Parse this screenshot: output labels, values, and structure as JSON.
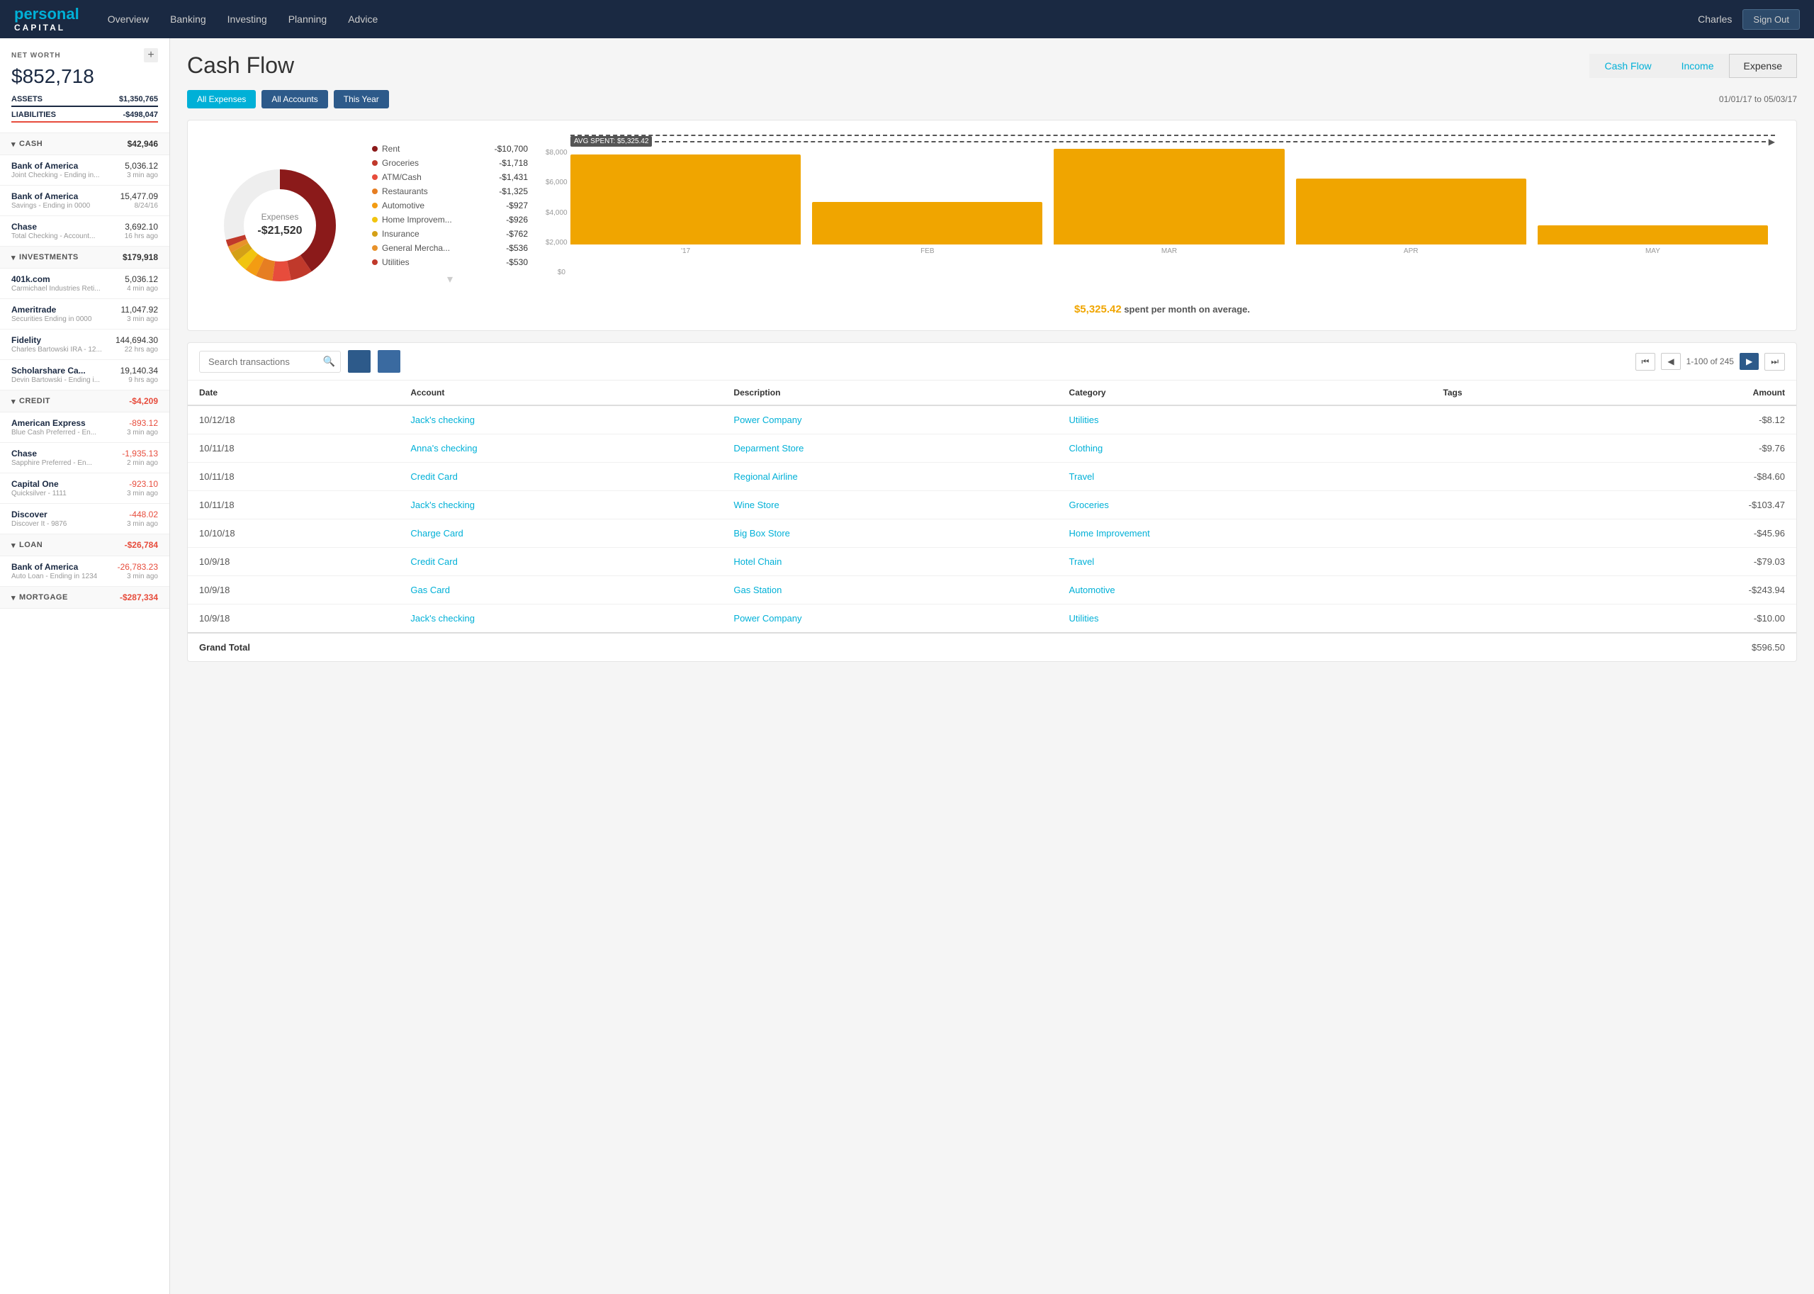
{
  "header": {
    "logo_line1": "personal",
    "logo_line2": "CAPITAL",
    "nav": [
      "Overview",
      "Banking",
      "Investing",
      "Planning",
      "Advice"
    ],
    "user": "Charles",
    "signout": "Sign Out"
  },
  "sidebar": {
    "add_btn": "+",
    "net_worth_label": "NET WORTH",
    "net_worth_value": "$852,718",
    "assets_label": "ASSETS",
    "assets_value": "$1,350,765",
    "liabilities_label": "LIABILITIES",
    "liabilities_value": "-$498,047",
    "sections": [
      {
        "label": "CASH",
        "value": "$42,946",
        "negative": false,
        "accounts": [
          {
            "name": "Bank of America",
            "sub": "Joint Checking - Ending in...",
            "amount": "5,036.12",
            "time": "3 min ago",
            "negative": false
          },
          {
            "name": "Bank of America",
            "sub": "Savings - Ending in 0000",
            "amount": "15,477.09",
            "time": "8/24/16",
            "negative": false
          },
          {
            "name": "Chase",
            "sub": "Total Checking - Account...",
            "amount": "3,692.10",
            "time": "16 hrs ago",
            "negative": false
          }
        ]
      },
      {
        "label": "INVESTMENTS",
        "value": "$179,918",
        "negative": false,
        "accounts": [
          {
            "name": "401k.com",
            "sub": "Carmichael Industries Reti...",
            "amount": "5,036.12",
            "time": "4 min ago",
            "negative": false
          },
          {
            "name": "Ameritrade",
            "sub": "Securities Ending in 0000",
            "amount": "11,047.92",
            "time": "3 min ago",
            "negative": false
          },
          {
            "name": "Fidelity",
            "sub": "Charles Bartowski IRA - 12...",
            "amount": "144,694.30",
            "time": "22 hrs ago",
            "negative": false
          },
          {
            "name": "Scholarshare Ca...",
            "sub": "Devin Bartowski - Ending i...",
            "amount": "19,140.34",
            "time": "9 hrs ago",
            "negative": false
          }
        ]
      },
      {
        "label": "CREDIT",
        "value": "-$4,209",
        "negative": true,
        "accounts": [
          {
            "name": "American Express",
            "sub": "Blue Cash Preferred - En...",
            "amount": "-893.12",
            "time": "3 min ago",
            "negative": true
          },
          {
            "name": "Chase",
            "sub": "Sapphire Preferred - En...",
            "amount": "-1,935.13",
            "time": "2 min ago",
            "negative": true
          },
          {
            "name": "Capital One",
            "sub": "Quicksilver - 1111",
            "amount": "-923.10",
            "time": "3 min ago",
            "negative": true
          },
          {
            "name": "Discover",
            "sub": "Discover It - 9876",
            "amount": "-448.02",
            "time": "3 min ago",
            "negative": true
          }
        ]
      },
      {
        "label": "LOAN",
        "value": "-$26,784",
        "negative": true,
        "accounts": [
          {
            "name": "Bank of America",
            "sub": "Auto Loan - Ending in 1234",
            "amount": "-26,783.23",
            "time": "3 min ago",
            "negative": true
          }
        ]
      },
      {
        "label": "MORTGAGE",
        "value": "-$287,334",
        "negative": true,
        "accounts": []
      }
    ]
  },
  "page": {
    "title": "Cash Flow",
    "tabs": [
      "Cash Flow",
      "Income",
      "Expense"
    ],
    "active_tab": "Expense"
  },
  "filter_bar": {
    "all_expenses": "All Expenses",
    "all_accounts": "All Accounts",
    "this_year": "This Year",
    "date_range": "01/01/17  to  05/03/17"
  },
  "donut": {
    "center_label": "Expenses",
    "center_value": "-$21,520"
  },
  "legend": [
    {
      "label": "Rent",
      "value": "-$10,700",
      "color": "#8B1A1A"
    },
    {
      "label": "Groceries",
      "value": "-$1,718",
      "color": "#c0392b"
    },
    {
      "label": "ATM/Cash",
      "value": "-$1,431",
      "color": "#e74c3c"
    },
    {
      "label": "Restaurants",
      "value": "-$1,325",
      "color": "#e67e22"
    },
    {
      "label": "Automotive",
      "value": "-$927",
      "color": "#f39c12"
    },
    {
      "label": "Home Improvem...",
      "value": "-$926",
      "color": "#f1c40f"
    },
    {
      "label": "Insurance",
      "value": "-$762",
      "color": "#d4a017"
    },
    {
      "label": "General Mercha...",
      "value": "-$536",
      "color": "#e8922a"
    },
    {
      "label": "Utilities",
      "value": "-$530",
      "color": "#c0392b"
    }
  ],
  "bar_chart": {
    "avg_label": "AVG SPENT: $5,325.42",
    "avg_pct": 66,
    "bars": [
      {
        "label": "'17",
        "height_pct": 85
      },
      {
        "label": "FEB",
        "height_pct": 40
      },
      {
        "label": "MAR",
        "height_pct": 100
      },
      {
        "label": "APR",
        "height_pct": 62
      },
      {
        "label": "MAY",
        "height_pct": 18
      }
    ],
    "y_labels": [
      "$8,000",
      "$6,000",
      "$4,000",
      "$2,000",
      "$0"
    ],
    "avg_text": "$5,325.42",
    "avg_suffix": " spent per month on average."
  },
  "transactions": {
    "search_placeholder": "Search transactions",
    "pagination": "1-100 of 245",
    "columns": [
      "Date",
      "Account",
      "Description",
      "Category",
      "Tags",
      "Amount"
    ],
    "rows": [
      {
        "date": "10/12/18",
        "account": "Jack's checking",
        "desc": "Power Company",
        "cat": "Utilities",
        "tags": "",
        "amount": "-$8.12"
      },
      {
        "date": "10/11/18",
        "account": "Anna's checking",
        "desc": "Deparment Store",
        "cat": "Clothing",
        "tags": "",
        "amount": "-$9.76"
      },
      {
        "date": "10/11/18",
        "account": "Credit Card",
        "desc": "Regional Airline",
        "cat": "Travel",
        "tags": "",
        "amount": "-$84.60"
      },
      {
        "date": "10/11/18",
        "account": "Jack's checking",
        "desc": "Wine Store",
        "cat": "Groceries",
        "tags": "",
        "amount": "-$103.47"
      },
      {
        "date": "10/10/18",
        "account": "Charge Card",
        "desc": "Big Box Store",
        "cat": "Home Improvement",
        "tags": "",
        "amount": "-$45.96"
      },
      {
        "date": "10/9/18",
        "account": "Credit Card",
        "desc": "Hotel Chain",
        "cat": "Travel",
        "tags": "",
        "amount": "-$79.03"
      },
      {
        "date": "10/9/18",
        "account": "Gas Card",
        "desc": "Gas Station",
        "cat": "Automotive",
        "tags": "",
        "amount": "-$243.94"
      },
      {
        "date": "10/9/18",
        "account": "Jack's checking",
        "desc": "Power Company",
        "cat": "Utilities",
        "tags": "",
        "amount": "-$10.00"
      }
    ],
    "grand_total_label": "Grand Total",
    "grand_total_value": "$596.50"
  }
}
